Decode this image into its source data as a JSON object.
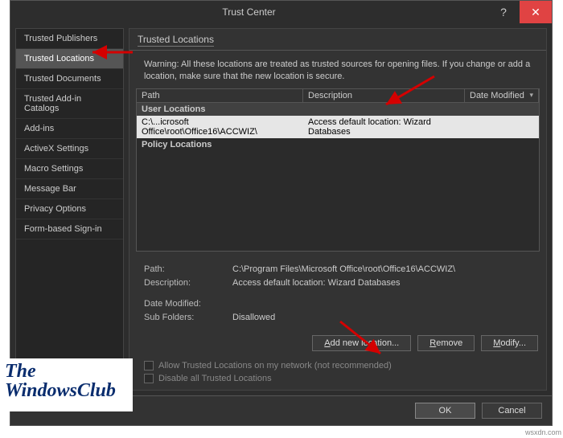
{
  "window": {
    "title": "Trust Center"
  },
  "titlebar": {
    "help_label": "?",
    "close_label": "✕"
  },
  "sidebar": {
    "items": [
      {
        "label": "Trusted Publishers"
      },
      {
        "label": "Trusted Locations"
      },
      {
        "label": "Trusted Documents"
      },
      {
        "label": "Trusted Add-in Catalogs"
      },
      {
        "label": "Add-ins"
      },
      {
        "label": "ActiveX Settings"
      },
      {
        "label": "Macro Settings"
      },
      {
        "label": "Message Bar"
      },
      {
        "label": "Privacy Options"
      },
      {
        "label": "Form-based Sign-in"
      }
    ],
    "selected_index": 1
  },
  "main": {
    "heading": "Trusted Locations",
    "warning": "Warning: All these locations are treated as trusted sources for opening files.  If you change or add a location, make sure that the new location is secure.",
    "columns": {
      "path": "Path",
      "description": "Description",
      "date": "Date Modified"
    },
    "groups": {
      "user": "User Locations",
      "policy": "Policy Locations"
    },
    "rows": [
      {
        "path": "C:\\...icrosoft Office\\root\\Office16\\ACCWIZ\\",
        "description": "Access default location: Wizard Databases",
        "date": ""
      }
    ],
    "details": {
      "path_label": "Path:",
      "path_value": "C:\\Program Files\\Microsoft Office\\root\\Office16\\ACCWIZ\\",
      "desc_label": "Description:",
      "desc_value": "Access default location: Wizard Databases",
      "date_label": "Date Modified:",
      "date_value": "",
      "sub_label": "Sub Folders:",
      "sub_value": "Disallowed"
    },
    "buttons": {
      "add": "Add new location...",
      "remove": "Remove",
      "modify": "Modify..."
    },
    "checkboxes": {
      "allow_network": "Allow Trusted Locations on my network (not recommended)",
      "disable_all": "Disable all Trusted Locations"
    }
  },
  "footer": {
    "ok": "OK",
    "cancel": "Cancel"
  },
  "watermark": {
    "line1": "The",
    "line2": "WindowsClub"
  },
  "corner": "wsxdn.com"
}
